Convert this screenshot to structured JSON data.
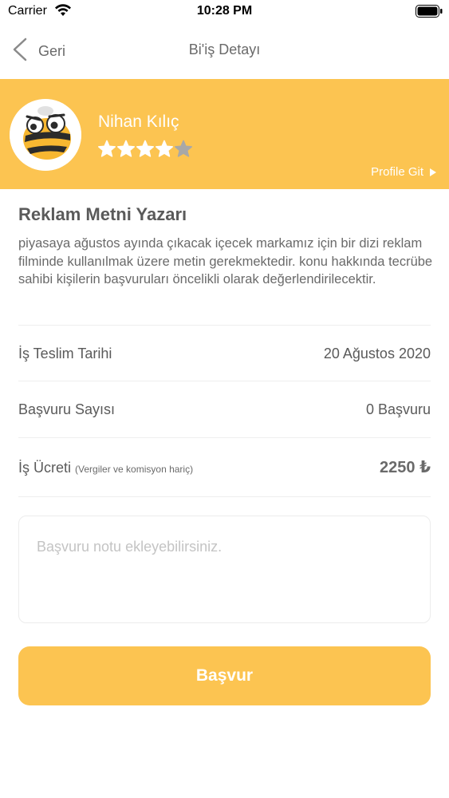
{
  "status_bar": {
    "carrier": "Carrier",
    "time": "10:28 PM"
  },
  "nav": {
    "back_label": "Geri",
    "title": "Bi'iş Detayı"
  },
  "profile": {
    "name": "Nihan Kılıç",
    "rating": 4,
    "rating_max": 5,
    "link_label": "Profile Git",
    "banner_color": "#fcc451"
  },
  "job": {
    "title": "Reklam Metni Yazarı",
    "description": "piyasaya ağustos ayında çıkacak içecek markamız için bir dizi reklam filminde kullanılmak üzere metin gerekmektedir. konu hakkında tecrübe sahibi kişilerin başvuruları öncelikli olarak değerlendirilecektir."
  },
  "details": {
    "deadline": {
      "label": "İş Teslim Tarihi",
      "value": "20 Ağustos 2020"
    },
    "applications": {
      "label": "Başvuru Sayısı",
      "value": "0 Başvuru"
    },
    "fee": {
      "label": "İş Ücreti",
      "note": "(Vergiler ve komisyon hariç)",
      "value": "2250 ₺"
    }
  },
  "note_input": {
    "placeholder": "Başvuru notu ekleyebilirsiniz.",
    "value": ""
  },
  "apply_button": {
    "label": "Başvur",
    "color": "#fcc451"
  }
}
